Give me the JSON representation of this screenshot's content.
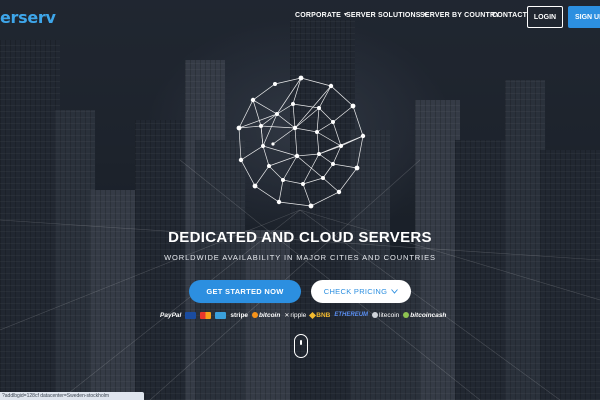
{
  "brand": {
    "logo_text": "erserv",
    "accent": "#3ea6ea"
  },
  "nav": {
    "items": [
      {
        "label": "CORPORATE",
        "has_dropdown": true
      },
      {
        "label": "SERVER SOLUTIONS",
        "has_dropdown": true
      },
      {
        "label": "SERVER BY COUNTRY",
        "has_dropdown": false
      },
      {
        "label": "CONTACT",
        "has_dropdown": false
      }
    ],
    "login_label": "LOGIN",
    "signup_label": "SIGN UP"
  },
  "hero": {
    "headline": "DEDICATED AND CLOUD SERVERS",
    "subline": "WORLDWIDE AVAILABILITY IN MAJOR CITIES AND COUNTRIES",
    "primary_cta": "GET STARTED NOW",
    "secondary_cta": "CHECK PRICING",
    "secondary_cta_icon": "chevron-down-icon"
  },
  "payments": [
    {
      "name": "paypal",
      "label": "PayPal"
    },
    {
      "name": "visa",
      "label": ""
    },
    {
      "name": "mastercard",
      "label": ""
    },
    {
      "name": "amex",
      "label": ""
    },
    {
      "name": "stripe",
      "label": "stripe"
    },
    {
      "name": "bitcoin",
      "label": "bitcoin"
    },
    {
      "name": "ripple",
      "label": "ripple"
    },
    {
      "name": "bnb",
      "label": "BNB"
    },
    {
      "name": "ethereum",
      "label": "ETHEREUM"
    },
    {
      "name": "litecoin",
      "label": "litecoin"
    },
    {
      "name": "bitcoincash",
      "label": "bitcoincash"
    }
  ],
  "scroll_indicator": "mouse-scroll-icon",
  "statusbar": {
    "url": "?addlbgid=128cf datacenter=Sweden-stockholm"
  },
  "colors": {
    "primary_button": "#2c8fe0",
    "background": "#1d2430",
    "text": "#ffffff"
  }
}
